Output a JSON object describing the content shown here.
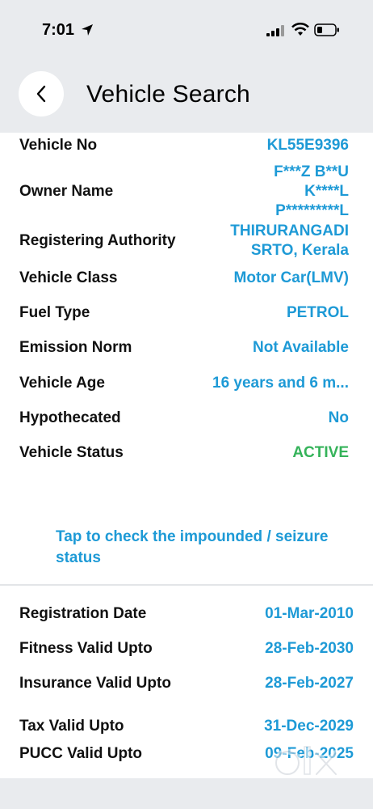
{
  "status_bar": {
    "time": "7:01"
  },
  "header": {
    "title": "Vehicle Search"
  },
  "details": [
    {
      "label": "Vehicle No",
      "value": "KL55E9396"
    },
    {
      "label": "Owner Name",
      "value_lines": [
        "F***Z B**U",
        "K****L",
        "P*********L"
      ]
    },
    {
      "label": "Registering Authority",
      "value_lines": [
        "THIRURANGADI",
        "SRTO, Kerala"
      ]
    },
    {
      "label": "Vehicle Class",
      "value": "Motor Car(LMV)"
    },
    {
      "label": "Fuel Type",
      "value": "PETROL"
    },
    {
      "label": "Emission Norm",
      "value": "Not Available"
    },
    {
      "label": "Vehicle Age",
      "value": "16 years and 6 m..."
    },
    {
      "label": "Hypothecated",
      "value": "No"
    },
    {
      "label": "Vehicle Status",
      "value": "ACTIVE",
      "status_color": "#35b35a"
    }
  ],
  "impound_link": {
    "text": "Tap to check the impounded / seizure status"
  },
  "validity": [
    {
      "label": "Registration Date",
      "value": "01-Mar-2010"
    },
    {
      "label": "Fitness Valid Upto",
      "value": "28-Feb-2030"
    },
    {
      "label": "Insurance Valid Upto",
      "value": "28-Feb-2027"
    },
    {
      "label": "Tax Valid Upto",
      "value": "31-Dec-2029"
    },
    {
      "label": "PUCC Valid Upto",
      "value": "09-Feb-2025"
    }
  ],
  "watermark": {
    "text": "olx"
  },
  "colors": {
    "accent": "#1e9ad6",
    "active": "#35b35a",
    "header_bg": "#e9ebee"
  }
}
